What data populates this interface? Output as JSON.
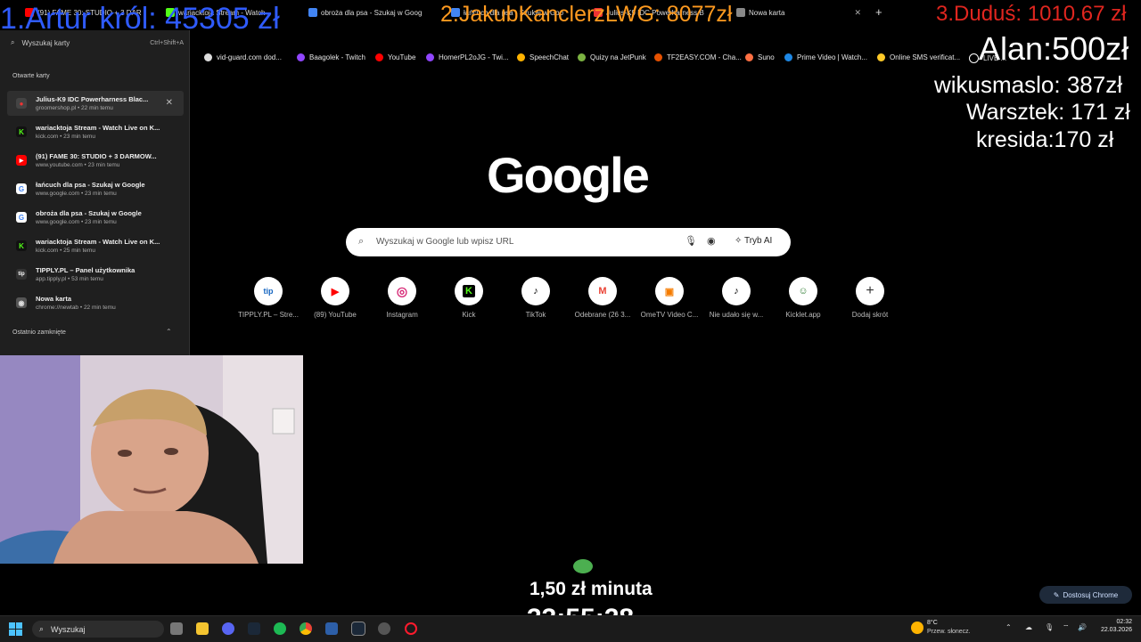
{
  "tabs": [
    {
      "label": "(91) FAME 30: STUDIO + 3 DAR",
      "color": "#ff0000"
    },
    {
      "label": "wariacktoja Stream - Watch",
      "color": "#53fc18"
    },
    {
      "label": "obroża dla psa - Szukaj w Goog",
      "color": "#4285f4"
    },
    {
      "label": "łańcuch dla psa - Szukaj w Goo",
      "color": "#4285f4"
    },
    {
      "label": "Julius-K9 IDC Powerharness B",
      "color": "#e33"
    },
    {
      "label": "Nowa karta",
      "color": "#888"
    }
  ],
  "new_tab_glyph": "+",
  "bookmarks": [
    {
      "label": "vid-guard.com dod...",
      "color": "#ddd"
    },
    {
      "label": "Baagolek - Twitch",
      "color": "#9146ff"
    },
    {
      "label": "YouTube",
      "color": "#ff0000"
    },
    {
      "label": "HomerPL2oJG - Twi...",
      "color": "#9146ff"
    },
    {
      "label": "SpeechChat",
      "color": "#ffb300"
    },
    {
      "label": "Quizy na JetPunk",
      "color": "#7cb342"
    },
    {
      "label": "TF2EASY.COM - Cha...",
      "color": "#e65100"
    },
    {
      "label": "Suno",
      "color": "#ff7043"
    },
    {
      "label": "Prime Video | Watch...",
      "color": "#1e88e5"
    },
    {
      "label": "Online SMS verificat...",
      "color": "#ffca28"
    },
    {
      "label": "LIVE ..."
    }
  ],
  "overlay": {
    "top1": "1.Artur król: 45305 zł",
    "top2": "2.JakubKanclerzLWG: 8077zł",
    "top3": "3.Duduś: 1010.67 zł",
    "donors": [
      "Alan:500zł",
      "wikusmaslo: 387zł",
      "Warsztek: 171 zł",
      "kresida:170 zł"
    ],
    "rate": "1,50 zł minuta",
    "timer": "33:55:28"
  },
  "tab_panel": {
    "search_placeholder": "Wyszukaj karty",
    "shortcut": "Ctrl+Shift+A",
    "open_tabs_header": "Otwarte karty",
    "recent_header": "Ostatnio zamknięte",
    "items": [
      {
        "title": "Julius-K9 IDC Powerharness Blac...",
        "sub": "groomershop.pl • 22 min temu",
        "color": "#e33",
        "glyph": "●"
      },
      {
        "title": "wariacktoja Stream - Watch Live on K...",
        "sub": "kick.com • 23 min temu",
        "color": "#53fc18",
        "glyph": "K"
      },
      {
        "title": "(91) FAME 30: STUDIO + 3 DARMOW...",
        "sub": "www.youtube.com • 23 min temu",
        "color": "#ff0000",
        "glyph": "▶"
      },
      {
        "title": "łańcuch dla psa - Szukaj w Google",
        "sub": "www.google.com • 23 min temu",
        "color": "#fff",
        "glyph": "G"
      },
      {
        "title": "obroża dla psa - Szukaj w Google",
        "sub": "www.google.com • 23 min temu",
        "color": "#fff",
        "glyph": "G"
      },
      {
        "title": "wariacktoja Stream - Watch Live on K...",
        "sub": "kick.com • 25 min temu",
        "color": "#53fc18",
        "glyph": "K"
      },
      {
        "title": "TIPPLY.PL – Panel użytkownika",
        "sub": "app.tipply.pl • 53 min temu",
        "color": "#333",
        "glyph": "tip"
      },
      {
        "title": "Nowa karta",
        "sub": "chrome://newtab • 22 min temu",
        "color": "#666",
        "glyph": "◉"
      }
    ],
    "bottom_sub": "www.google.com • 10 godzin temu"
  },
  "google": {
    "logo": "Google",
    "search_placeholder": "Wyszukaj w Google lub wpisz URL",
    "ai_mode": "Tryb AI",
    "shortcuts": [
      {
        "label": "TIPPLY.PL – Stre...",
        "glyph": "tip",
        "color": "#1565c0"
      },
      {
        "label": "(89) YouTube",
        "glyph": "▶",
        "color": "#ff0000"
      },
      {
        "label": "Instagram",
        "glyph": "◎",
        "color": "#d62976"
      },
      {
        "label": "Kick",
        "glyph": "K",
        "color": "#53fc18"
      },
      {
        "label": "TikTok",
        "glyph": "♪",
        "color": "#000"
      },
      {
        "label": "Odebrane (26 3...",
        "glyph": "M",
        "color": "#ea4335"
      },
      {
        "label": "OmeTV Video C...",
        "glyph": "▣",
        "color": "#f57c00"
      },
      {
        "label": "Nie udało się w...",
        "glyph": "♪",
        "color": "#000"
      },
      {
        "label": "Kicklet.app",
        "glyph": "☺",
        "color": "#2e7d32"
      },
      {
        "label": "Dodaj skrót",
        "glyph": "+",
        "color": "#333"
      }
    ]
  },
  "customize_chrome": "Dostosuj Chrome",
  "taskbar": {
    "search": "Wyszukaj",
    "weather_temp": "8°C",
    "weather_desc": "Przew. słonecz.",
    "time": "02:32",
    "date": "22.03.2026"
  }
}
